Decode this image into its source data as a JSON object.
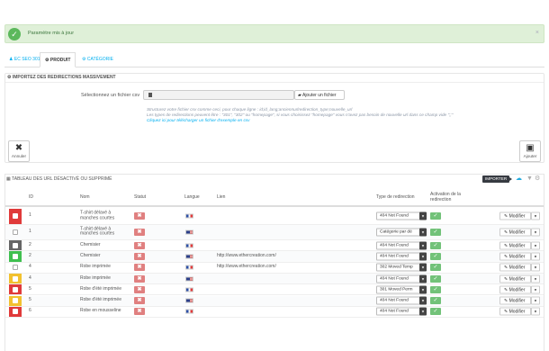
{
  "alert": {
    "message": "Paramètre mis à jour",
    "close": "×"
  },
  "tabs": [
    {
      "label": "EC SEO 301"
    },
    {
      "label": "PRODUIT"
    },
    {
      "label": "CATÉGORIE"
    }
  ],
  "import_panel": {
    "title": "IMPORTEZ DES REDIRECTIONS MASSIVEMENT",
    "file_label": "Sélectionnez un fichier csv",
    "add_file": "Ajouter un fichier",
    "help_line1": "Structurez votre fichier csv comme ceci, pour chaque ligne : id;id_lang;anciennurlredirection_type;nouvelle_url",
    "help_line2": "Les types de redirections peuvent être : \"301\", \"302\" ou \"homepage\", si vous choisissez \"homepage\" vous n'avez pas besoin de nouvelle url dans ce champ vide \";;\"",
    "help_link": "Cliquez ici pour télécharger un fichier d'exemple en csv",
    "cancel": "Annuler",
    "add": "Ajouter"
  },
  "table": {
    "title": "TABLEAU DES URL DÉSACTIVÉ OU SUPPRIMÉ",
    "import_label": "IMPORTER",
    "headers": {
      "id": "ID",
      "name": "Nom",
      "status": "Statut",
      "lang": "Langue",
      "link": "Lien",
      "type": "Type de redirection",
      "activation_1": "Activation de la",
      "activation_2": "redirection"
    },
    "edit_label": "Modifier",
    "rows": [
      {
        "id": "1",
        "name_1": "T-shirt délavé à",
        "name_2": "manches courtes",
        "lang": "fr",
        "link": "",
        "type": "404 Not Found",
        "marker": "#e03a3a"
      },
      {
        "id": "1",
        "name_1": "T-shirt délavé à",
        "name_2": "manches courtes",
        "lang": "us",
        "link": "",
        "type": "Catégorie par dé",
        "marker": ""
      },
      {
        "id": "2",
        "name_1": "Chemisier",
        "name_2": "",
        "lang": "fr",
        "link": "",
        "type": "404 Not Found",
        "marker": "#666666"
      },
      {
        "id": "2",
        "name_1": "Chemisier",
        "name_2": "",
        "lang": "us",
        "link": "http://www.ethercreation.com/",
        "type": "404 Not Found",
        "marker": "#3fbf4f"
      },
      {
        "id": "4",
        "name_1": "Robe imprimée",
        "name_2": "",
        "lang": "fr",
        "link": "http://www.ethercreation.com/",
        "type": "302 Moved Temp",
        "marker": ""
      },
      {
        "id": "4",
        "name_1": "Robe imprimée",
        "name_2": "",
        "lang": "us",
        "link": "",
        "type": "404 Not Found",
        "marker": "#f2c12e"
      },
      {
        "id": "5",
        "name_1": "Robe d'été imprimée",
        "name_2": "",
        "lang": "fr",
        "link": "",
        "type": "301 Moved Perm",
        "marker": "#e03a3a"
      },
      {
        "id": "5",
        "name_1": "Robe d'été imprimée",
        "name_2": "",
        "lang": "us",
        "link": "",
        "type": "404 Not Found",
        "marker": "#f2c12e"
      },
      {
        "id": "6",
        "name_1": "Robe en mousseline",
        "name_2": "",
        "lang": "fr",
        "link": "",
        "type": "404 Not Found",
        "marker": "#e03a3a"
      }
    ]
  }
}
